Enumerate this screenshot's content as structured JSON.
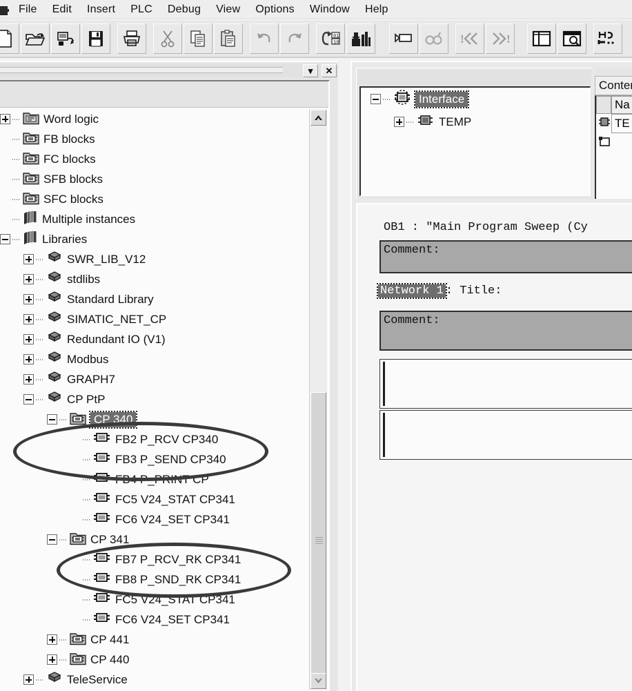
{
  "menu": {
    "items": [
      {
        "label": "File"
      },
      {
        "label": "Edit"
      },
      {
        "label": "Insert"
      },
      {
        "label": "PLC"
      },
      {
        "label": "Debug"
      },
      {
        "label": "View"
      },
      {
        "label": "Options"
      },
      {
        "label": "Window"
      },
      {
        "label": "Help"
      }
    ]
  },
  "toolbar": {
    "buttons": [
      {
        "name": "new-icon",
        "title": "New"
      },
      {
        "name": "open-icon",
        "title": "Open"
      },
      {
        "name": "save-as-icon",
        "title": "Save As"
      },
      {
        "name": "save-icon",
        "title": "Save"
      },
      {
        "name": "print-icon",
        "title": "Print"
      },
      {
        "name": "cut-icon",
        "title": "Cut"
      },
      {
        "name": "copy-icon",
        "title": "Copy"
      },
      {
        "name": "paste-icon",
        "title": "Paste"
      },
      {
        "name": "undo-icon",
        "title": "Undo"
      },
      {
        "name": "redo-icon",
        "title": "Redo"
      },
      {
        "name": "download-icon",
        "title": "Download"
      },
      {
        "name": "monitor-icon",
        "title": "Monitor"
      },
      {
        "name": "network-icon",
        "title": "Network"
      },
      {
        "name": "binoculars-icon",
        "title": "Find"
      },
      {
        "name": "prev-error-icon",
        "title": "Previous Error"
      },
      {
        "name": "next-error-icon",
        "title": "Next Error"
      },
      {
        "name": "overview-icon",
        "title": "Overview"
      },
      {
        "name": "zoom-view-icon",
        "title": "Zoom View"
      },
      {
        "name": "symbol-info-icon",
        "title": "Symbol Information"
      }
    ]
  },
  "left_window": {
    "title_buttons": [
      {
        "name": "window-restore-button",
        "glyph": "▾"
      },
      {
        "name": "window-close-button",
        "glyph": "✕"
      }
    ],
    "scrollbar": {
      "up_glyph": "▲",
      "down_glyph": "▼"
    },
    "tree": [
      {
        "label": "Word logic",
        "indent": 0,
        "expander": "plus",
        "icon": "folder-word-logic-icon"
      },
      {
        "label": "FB blocks",
        "indent": 0,
        "expander": "none",
        "icon": "folder-block-icon"
      },
      {
        "label": "FC blocks",
        "indent": 0,
        "expander": "none",
        "icon": "folder-block-icon"
      },
      {
        "label": "SFB blocks",
        "indent": 0,
        "expander": "none",
        "icon": "folder-block-icon"
      },
      {
        "label": "SFC blocks",
        "indent": 0,
        "expander": "none",
        "icon": "folder-block-icon"
      },
      {
        "label": "Multiple instances",
        "indent": 0,
        "expander": "none",
        "icon": "books-icon"
      },
      {
        "label": "Libraries",
        "indent": 0,
        "expander": "minus",
        "icon": "books-icon"
      },
      {
        "label": "SWR_LIB_V12",
        "indent": 1,
        "expander": "plus",
        "icon": "library-icon"
      },
      {
        "label": "stdlibs",
        "indent": 1,
        "expander": "plus",
        "icon": "library-icon"
      },
      {
        "label": "Standard Library",
        "indent": 1,
        "expander": "plus",
        "icon": "library-icon"
      },
      {
        "label": "SIMATIC_NET_CP",
        "indent": 1,
        "expander": "plus",
        "icon": "library-icon"
      },
      {
        "label": "Redundant IO (V1)",
        "indent": 1,
        "expander": "plus",
        "icon": "library-icon"
      },
      {
        "label": "Modbus",
        "indent": 1,
        "expander": "plus",
        "icon": "library-icon"
      },
      {
        "label": "GRAPH7",
        "indent": 1,
        "expander": "plus",
        "icon": "library-icon"
      },
      {
        "label": "CP PtP",
        "indent": 1,
        "expander": "minus",
        "icon": "library-icon"
      },
      {
        "label": "CP 340",
        "indent": 2,
        "expander": "minus",
        "icon": "folder-block-icon",
        "selected": true
      },
      {
        "label": "FB2   P_RCV   CP340",
        "indent": 3,
        "expander": "none",
        "icon": "fb-block-icon"
      },
      {
        "label": "FB3   P_SEND   CP340",
        "indent": 3,
        "expander": "none",
        "icon": "fb-block-icon"
      },
      {
        "label": "FB4   P_PRINT   CP",
        "indent": 3,
        "expander": "none",
        "icon": "fb-block-icon"
      },
      {
        "label": "FC5   V24_STAT   CP341",
        "indent": 3,
        "expander": "none",
        "icon": "fb-block-icon"
      },
      {
        "label": "FC6   V24_SET   CP341",
        "indent": 3,
        "expander": "none",
        "icon": "fb-block-icon"
      },
      {
        "label": "CP 341",
        "indent": 2,
        "expander": "minus",
        "icon": "folder-block-icon"
      },
      {
        "label": "FB7   P_RCV_RK   CP341",
        "indent": 3,
        "expander": "none",
        "icon": "fb-block-icon"
      },
      {
        "label": "FB8   P_SND_RK   CP341",
        "indent": 3,
        "expander": "none",
        "icon": "fb-block-icon"
      },
      {
        "label": "FC5   V24_STAT   CP341",
        "indent": 3,
        "expander": "none",
        "icon": "fb-block-icon"
      },
      {
        "label": "FC6   V24_SET   CP341",
        "indent": 3,
        "expander": "none",
        "icon": "fb-block-icon"
      },
      {
        "label": "CP 441",
        "indent": 2,
        "expander": "plus",
        "icon": "folder-block-icon"
      },
      {
        "label": "CP 440",
        "indent": 2,
        "expander": "plus",
        "icon": "folder-block-icon"
      },
      {
        "label": "TeleService",
        "indent": 1,
        "expander": "plus",
        "icon": "library-icon"
      }
    ],
    "annotations": [
      {
        "name": "highlight-ellipse-cp340",
        "shape": "ellipse"
      },
      {
        "name": "highlight-ellipse-cp341",
        "shape": "ellipse"
      }
    ]
  },
  "right_window": {
    "interface_tree": [
      {
        "label": "Interface",
        "indent": 0,
        "expander": "minus",
        "icon": "interface-icon",
        "selected": true
      },
      {
        "label": "TEMP",
        "indent": 1,
        "expander": "plus",
        "icon": "temp-var-icon"
      }
    ],
    "contents": {
      "title": "Conten",
      "column_header": "Na",
      "row_value": "TE"
    },
    "editor": {
      "block_title": "OB1 :   \"Main Program Sweep (Cy",
      "header_comment": "Comment:",
      "network_label": "Network 1",
      "network_title": ": Title:",
      "network_comment": "Comment:"
    }
  }
}
